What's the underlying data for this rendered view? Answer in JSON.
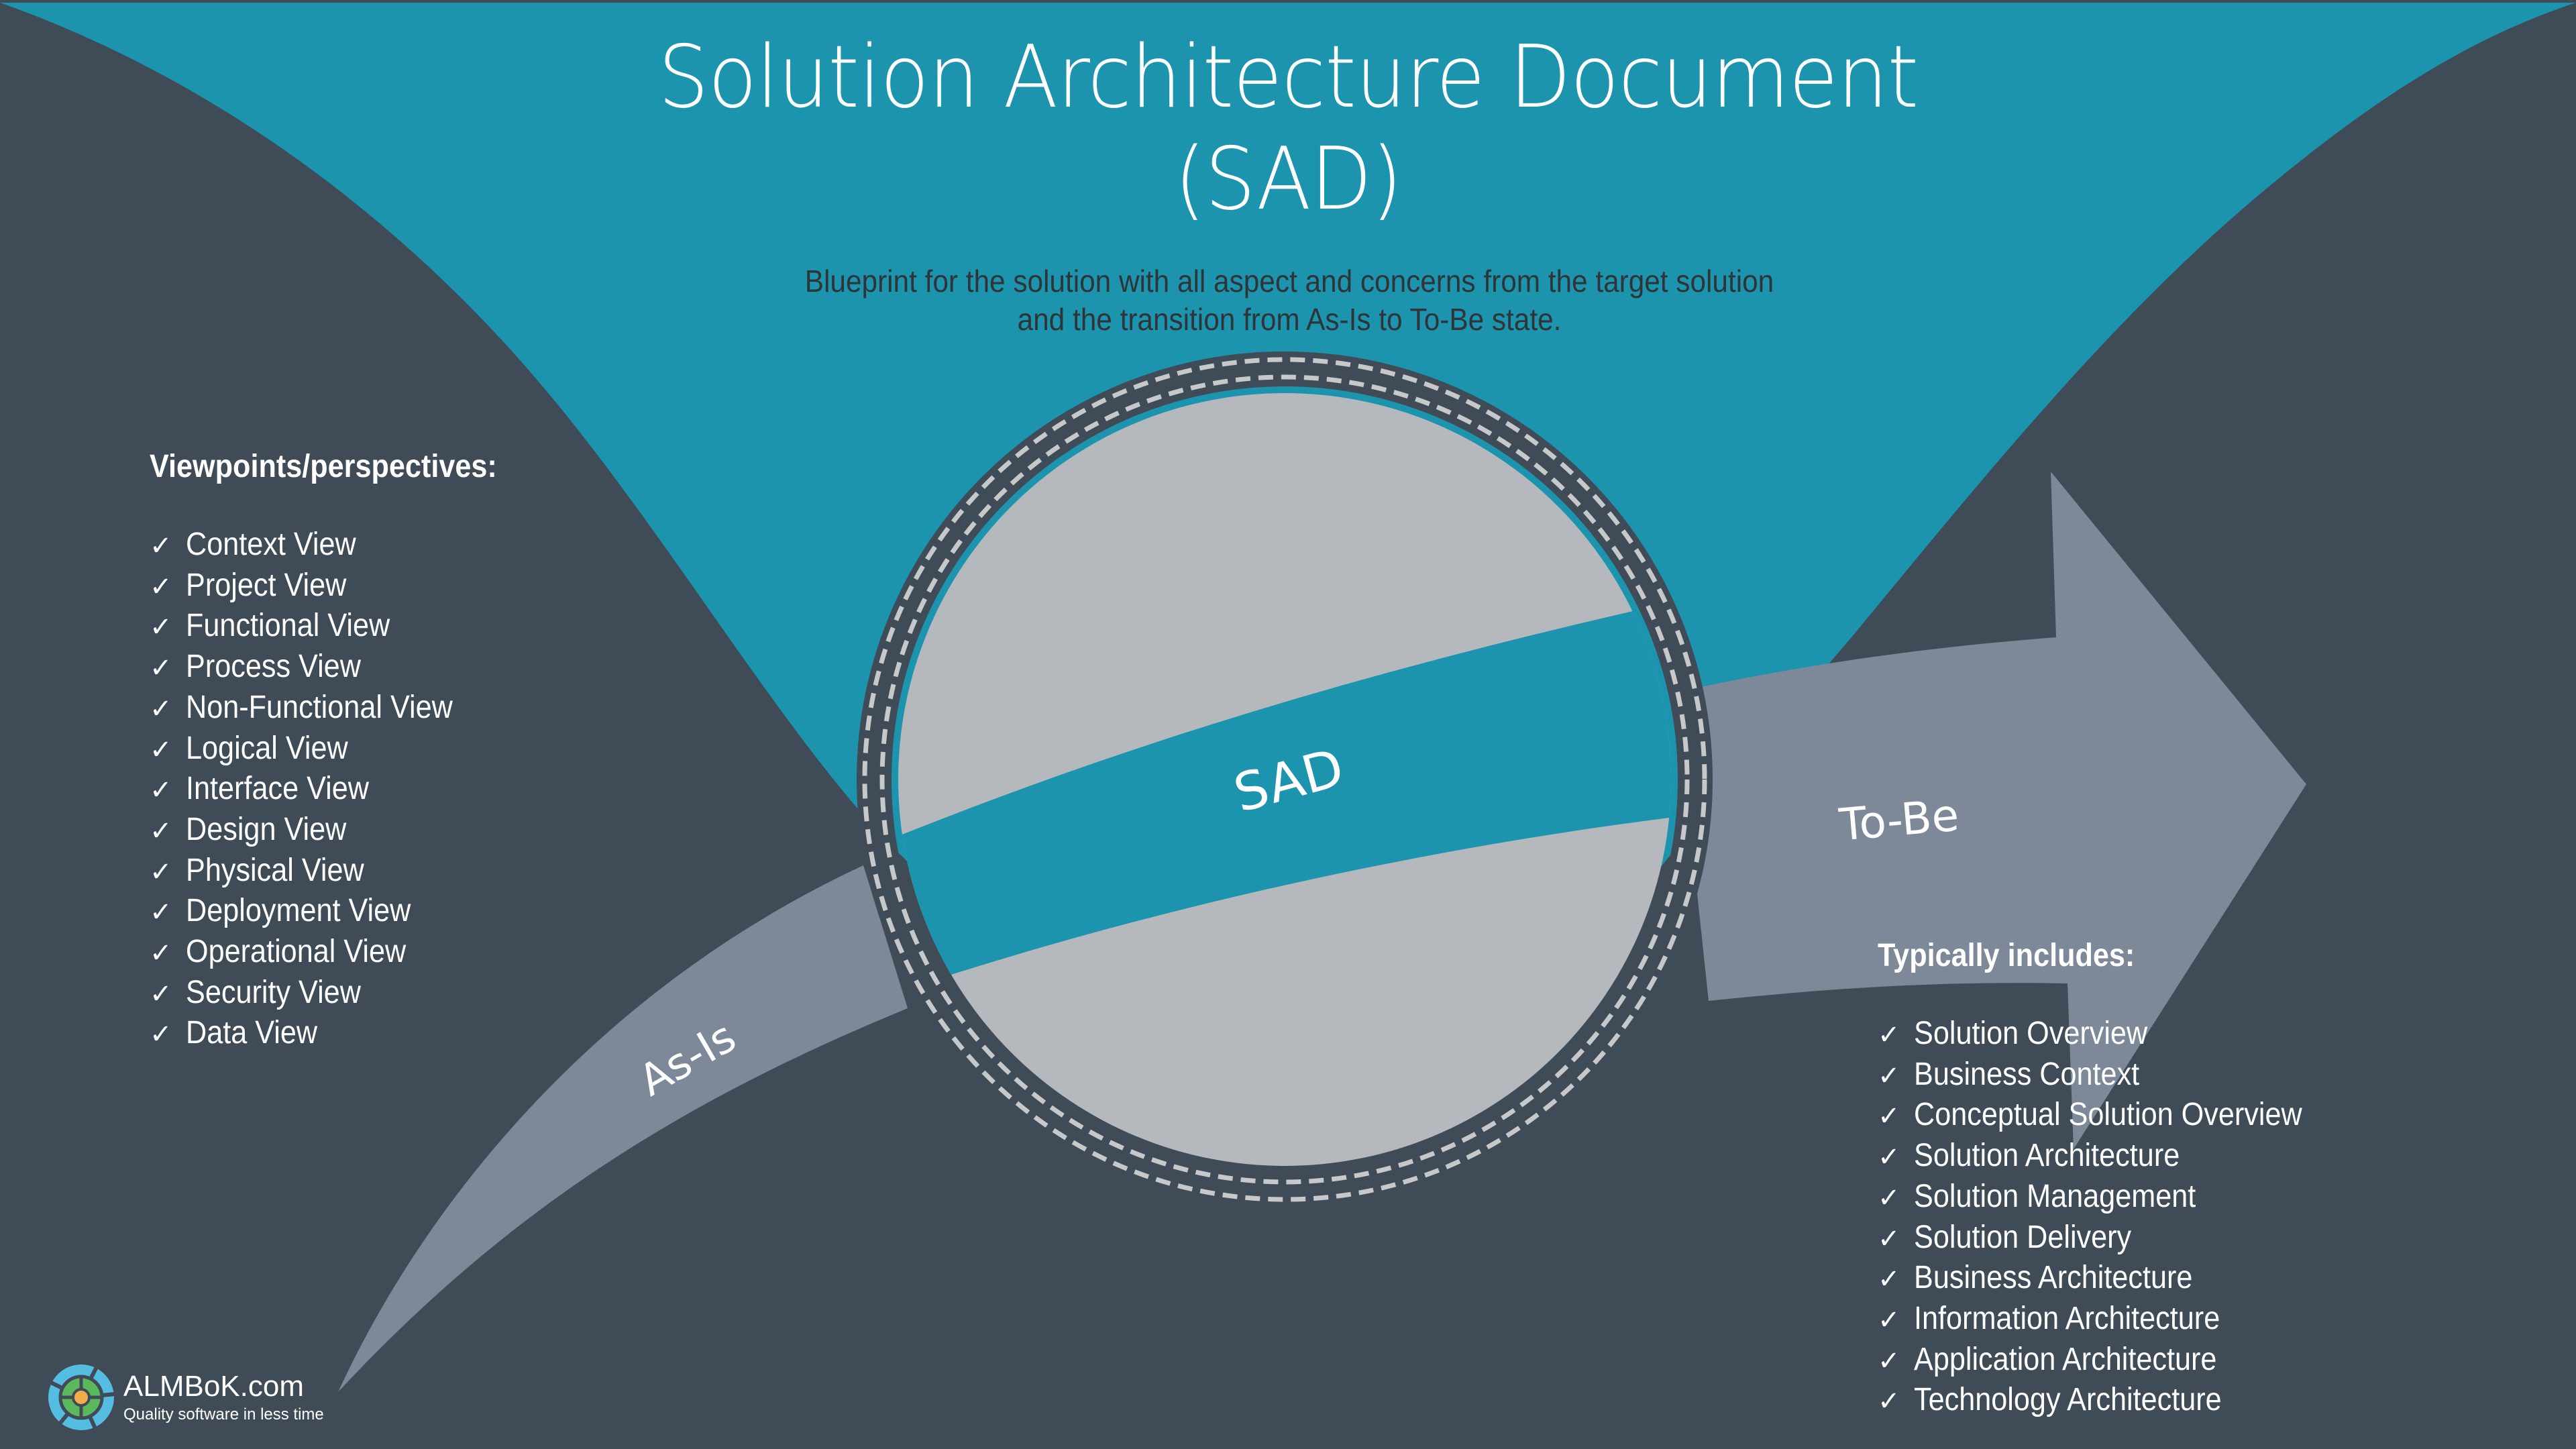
{
  "header": {
    "title_line1": "Solution Architecture Document",
    "title_line2": "(SAD)",
    "subtitle_line1": "Blueprint for the solution with all aspect and concerns from the target solution",
    "subtitle_line2": "and the transition from As-Is to To-Be state."
  },
  "diagram": {
    "center_label": "SAD",
    "as_is_label": "As-Is",
    "to_be_label": "To-Be"
  },
  "viewpoints": {
    "heading": "Viewpoints/perspectives:",
    "check_icon": "✓",
    "items": [
      "Context View",
      "Project View",
      "Functional View",
      "Process View",
      "Non-Functional View",
      "Logical View",
      "Interface View",
      "Design View",
      "Physical View",
      "Deployment View",
      "Operational View",
      "Security View",
      "Data View"
    ]
  },
  "includes": {
    "heading": "Typically includes:",
    "check_icon": "✓",
    "items": [
      "Solution Overview",
      "Business Context",
      "Conceptual Solution Overview",
      "Solution Architecture",
      "Solution Management",
      "Solution Delivery",
      "Business Architecture",
      "Information Architecture",
      "Application Architecture",
      "Technology Architecture"
    ]
  },
  "logo": {
    "name": "ALMBoK.com",
    "tagline": "Quality software in less time"
  },
  "colors": {
    "background": "#3f4b56",
    "teal": "#1c94ae",
    "arrow_gray": "#7d8898",
    "circle_gray": "#b5b8bd",
    "dash_gray": "#c7c8ca",
    "logo_blue": "#55bde0",
    "logo_green": "#5cb85c",
    "logo_orange": "#f0ad4e"
  }
}
